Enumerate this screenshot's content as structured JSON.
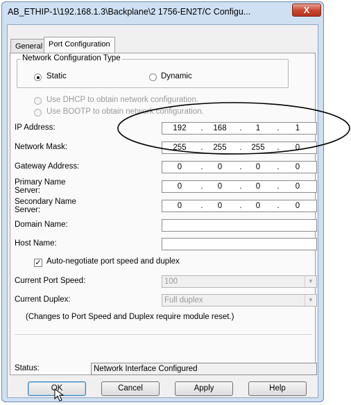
{
  "window": {
    "title": "AB_ETHIP-1\\192.168.1.3\\Backplane\\2 1756-EN2T/C Configu...",
    "close_label": "X"
  },
  "tabs": [
    {
      "label": "General"
    },
    {
      "label": "Port Configuration"
    }
  ],
  "network_config": {
    "legend": "Network Configuration Type",
    "static_label": "Static",
    "dynamic_label": "Dynamic",
    "selected": "Static",
    "dhcp_label": "Use DHCP to obtain network configuration.",
    "bootp_label": "Use BOOTP to obtain network configuration."
  },
  "fields": {
    "ip": {
      "label": "IP Address:",
      "octets": [
        "192",
        "168",
        "1",
        "1"
      ]
    },
    "mask": {
      "label": "Network Mask:",
      "octets": [
        "255",
        "255",
        "255",
        "0"
      ]
    },
    "gateway": {
      "label": "Gateway Address:",
      "octets": [
        "0",
        "0",
        "0",
        "0"
      ]
    },
    "primary_dns": {
      "label": "Primary Name Server:",
      "octets": [
        "0",
        "0",
        "0",
        "0"
      ]
    },
    "secondary_dns": {
      "label": "Secondary Name Server:",
      "octets": [
        "0",
        "0",
        "0",
        "0"
      ]
    },
    "domain": {
      "label": "Domain Name:",
      "value": ""
    },
    "host": {
      "label": "Host Name:",
      "value": ""
    }
  },
  "autoneg": {
    "label": "Auto-negotiate port speed and duplex",
    "checked": true
  },
  "port_speed": {
    "label": "Current Port Speed:",
    "value": "100"
  },
  "duplex": {
    "label": "Current Duplex:",
    "value": "Full duplex"
  },
  "note": "(Changes to Port Speed and Duplex require module reset.)",
  "status": {
    "label": "Status:",
    "value": "Network Interface Configured"
  },
  "buttons": {
    "ok": "OK",
    "cancel": "Cancel",
    "apply": "Apply",
    "help": "Help"
  },
  "annotation": {
    "ellipse_color": "#000000"
  }
}
